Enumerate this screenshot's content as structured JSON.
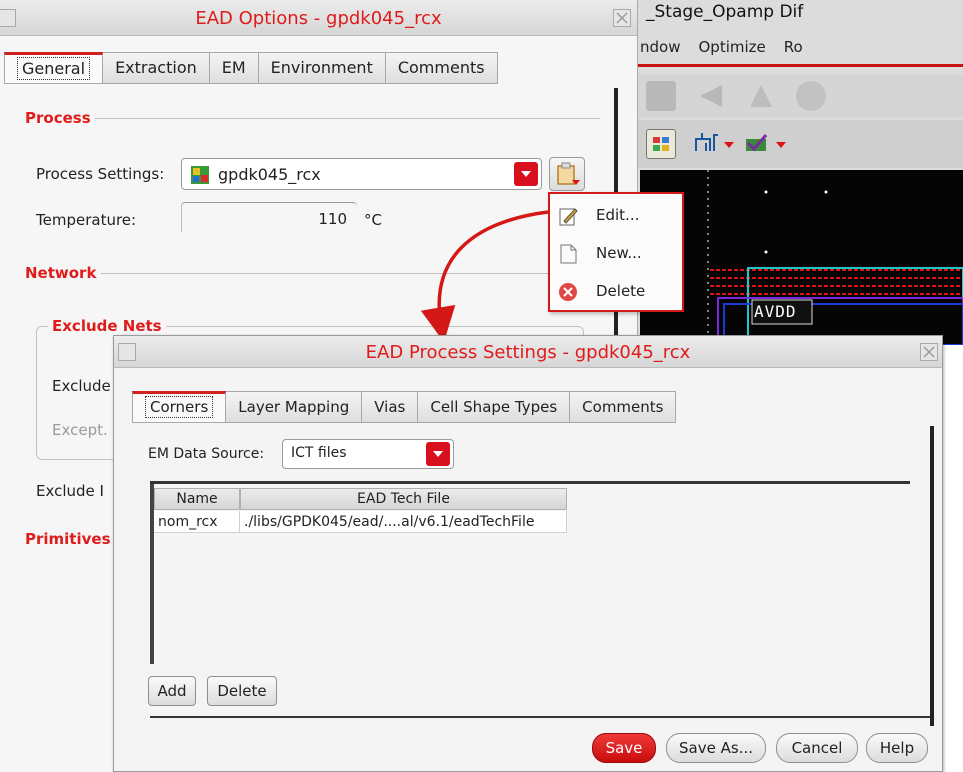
{
  "background_window": {
    "title": "_Stage_Opamp Dif",
    "menu": [
      "ndow",
      "Optimize",
      "Ro"
    ],
    "canvas_label": "AVDD"
  },
  "options_window": {
    "title": "EAD Options - gpdk045_rcx",
    "tabs": [
      "General",
      "Extraction",
      "EM",
      "Environment",
      "Comments"
    ],
    "active_tab": "General",
    "sections": {
      "process": "Process",
      "network": "Network",
      "exclude_nets": "Exclude Nets",
      "primitives": "Primitives"
    },
    "process_settings_label": "Process Settings:",
    "process_settings_value": "gpdk045_rcx",
    "temperature_label": "Temperature:",
    "temperature_value": "110",
    "temperature_unit": "°C",
    "exclude_label_1": "Exclude",
    "except_label": "Except.",
    "exclude_label_2": "Exclude I"
  },
  "popup_menu": {
    "items": [
      {
        "label": "Edit...",
        "icon": "edit-icon"
      },
      {
        "label": "New...",
        "icon": "document-icon"
      },
      {
        "label": "Delete",
        "icon": "delete-icon"
      }
    ]
  },
  "process_dialog": {
    "title": "EAD Process Settings - gpdk045_rcx",
    "tabs": [
      "Corners",
      "Layer Mapping",
      "Vias",
      "Cell Shape Types",
      "Comments"
    ],
    "active_tab": "Corners",
    "em_source_label": "EM Data Source:",
    "em_source_value": "ICT files",
    "table": {
      "headers": [
        "Name",
        "EAD Tech File"
      ],
      "rows": [
        [
          "nom_rcx",
          "./libs/GPDK045/ead/....al/v6.1/eadTechFile"
        ]
      ]
    },
    "add_button": "Add",
    "delete_button": "Delete",
    "save_button": "Save",
    "save_as_button": "Save As...",
    "cancel_button": "Cancel",
    "help_button": "Help"
  },
  "colors": {
    "accent": "#e01b1b",
    "primary_button": "#d01010"
  }
}
